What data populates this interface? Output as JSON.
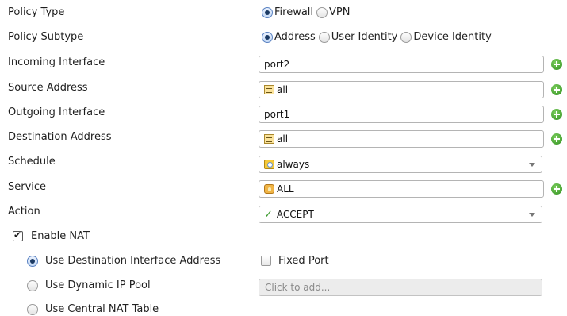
{
  "rows": {
    "policy_type": {
      "label": "Policy Type",
      "options": [
        "Firewall",
        "VPN"
      ],
      "selected": "Firewall"
    },
    "policy_subtype": {
      "label": "Policy Subtype",
      "options": [
        "Address",
        "User Identity",
        "Device Identity"
      ],
      "selected": "Address"
    },
    "incoming_interface": {
      "label": "Incoming Interface",
      "value": "port2"
    },
    "source_address": {
      "label": "Source Address",
      "value": "all",
      "icon": "address-icon"
    },
    "outgoing_interface": {
      "label": "Outgoing Interface",
      "value": "port1"
    },
    "destination_address": {
      "label": "Destination Address",
      "value": "all",
      "icon": "address-icon"
    },
    "schedule": {
      "label": "Schedule",
      "value": "always",
      "icon": "schedule-icon"
    },
    "service": {
      "label": "Service",
      "value": "ALL",
      "icon": "service-icon"
    },
    "action": {
      "label": "Action",
      "value": "ACCEPT",
      "icon": "checkmark-icon"
    }
  },
  "nat": {
    "enable_label": "Enable NAT",
    "enabled": true,
    "options": [
      {
        "label": "Use Destination Interface Address",
        "selected": true
      },
      {
        "label": "Use Dynamic IP Pool",
        "selected": false
      },
      {
        "label": "Use Central NAT Table",
        "selected": false
      }
    ],
    "fixed_port_label": "Fixed Port",
    "fixed_port_checked": false,
    "ip_pool_placeholder": "Click to add..."
  },
  "colors": {
    "add_button": "#3a9a2c",
    "radio_selected": "#1b3a63"
  }
}
